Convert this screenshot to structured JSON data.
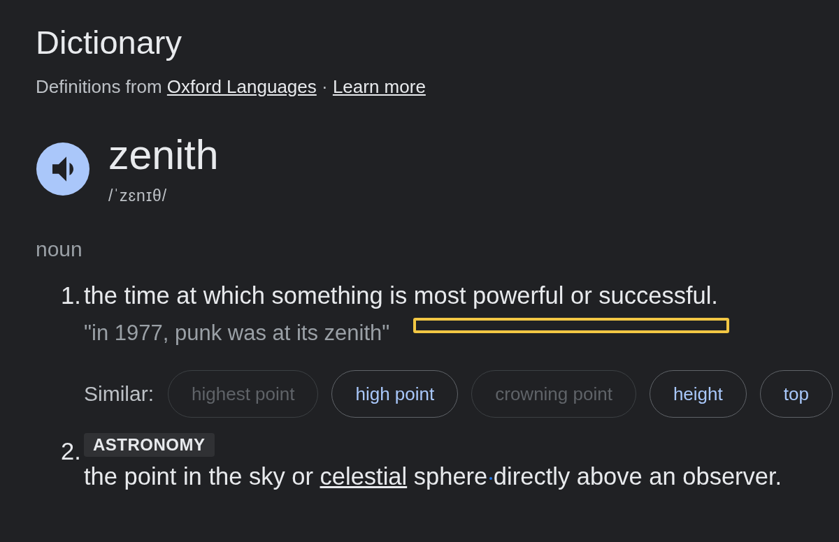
{
  "header": {
    "title": "Dictionary",
    "attribution": {
      "prefix": "Definitions from",
      "source_link": "Oxford Languages",
      "separator": "·",
      "learn_more_link": "Learn more"
    }
  },
  "entry": {
    "word": "zenith",
    "pronunciation": "/ˈzɛnɪθ/"
  },
  "part_of_speech": "noun",
  "senses": [
    {
      "number": "1.",
      "definition": [
        {
          "kind": "text",
          "text": "the time at which something is most powerful or successful."
        }
      ],
      "example": "\"in 1977, punk was at its zenith\"",
      "similar": {
        "label": "Similar:",
        "chips": [
          {
            "label": "highest point",
            "disabled": true
          },
          {
            "label": "high point",
            "disabled": false
          },
          {
            "label": "crowning point",
            "disabled": true
          },
          {
            "label": "height",
            "disabled": false
          },
          {
            "label": "top",
            "disabled": false
          }
        ]
      }
    },
    {
      "number": "2.",
      "tag": "ASTRONOMY",
      "definition": [
        {
          "kind": "text",
          "text": "the point in the sky or "
        },
        {
          "kind": "link",
          "text": "celestial"
        },
        {
          "kind": "text",
          "text": " sphere "
        },
        {
          "kind": "dot"
        },
        {
          "kind": "text",
          "text": "directly above an observer."
        }
      ]
    }
  ]
}
